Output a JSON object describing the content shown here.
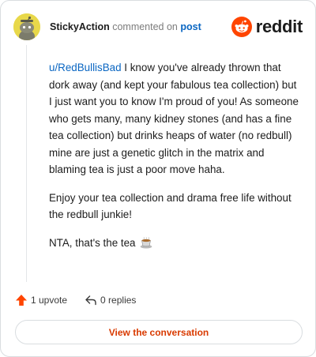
{
  "comment": {
    "username": "StickyAction",
    "verb": "commented on",
    "target_link": "post",
    "mention": "u/RedBullisBad",
    "paragraphs": [
      " I know you've already thrown that dork away (and kept your fabulous tea collection) but I just want you to know I'm proud of you! As someone who gets many, many kidney stones (and has a fine tea collection) but drinks heaps of water (no redbull) mine are just a genetic glitch in the matrix and blaming tea is just a poor move haha.",
      "Enjoy your tea collection and drama free life without the redbull junkie!",
      "NTA, that's the tea"
    ]
  },
  "brand": {
    "wordmark": "reddit",
    "color": "#ff4500"
  },
  "actions": {
    "upvote_label": "1 upvote",
    "replies_label": "0 replies"
  },
  "cta": {
    "label": "View the conversation",
    "color": "#d93a00"
  },
  "icons": {
    "avatar": "snoo-avatar-icon",
    "logo": "reddit-logo-icon",
    "upvote": "upvote-arrow-icon",
    "reply": "reply-arrow-icon",
    "emoji": "tea-cup-emoji-icon"
  }
}
